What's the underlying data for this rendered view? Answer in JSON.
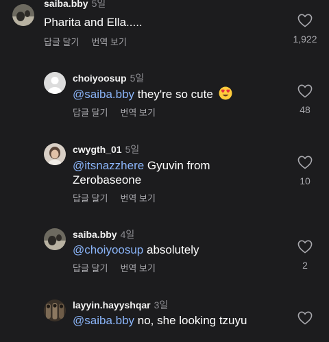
{
  "comments": [
    {
      "username": "saiba.bby",
      "time": "5일",
      "text": "Pharita and Ella.....",
      "reply": "답글 달기",
      "translate": "번역 보기",
      "likes": "1,922",
      "avatar_icon": "avatar-icon"
    },
    {
      "username": "choiyoosup",
      "time": "5일",
      "mention": "@saiba.bby",
      "text": " they're so cute",
      "emoji": "heart-eyes-emoji",
      "reply": "답글 달기",
      "translate": "번역 보기",
      "likes": "48",
      "avatar_icon": "default-avatar-icon"
    },
    {
      "username": "cwygth_01",
      "time": "5일",
      "mention": "@itsnazzhere",
      "text": " Gyuvin from",
      "text2": "Zerobaseone",
      "reply": "답글 달기",
      "translate": "번역 보기",
      "likes": "10",
      "avatar_icon": "avatar-icon"
    },
    {
      "username": "saiba.bby",
      "time": "4일",
      "mention": "@choiyoosup",
      "text": " absolutely",
      "reply": "답글 달기",
      "translate": "번역 보기",
      "likes": "2",
      "avatar_icon": "avatar-icon"
    },
    {
      "username": "layyin.hayyshqar",
      "time": "3일",
      "mention": "@saiba.bby",
      "text": " no, she looking tzuyu",
      "avatar_icon": "avatar-icon"
    }
  ],
  "colors": {
    "background": "#1c1c1e",
    "mention": "#8ab4f8",
    "secondary": "#a8a8ad"
  }
}
